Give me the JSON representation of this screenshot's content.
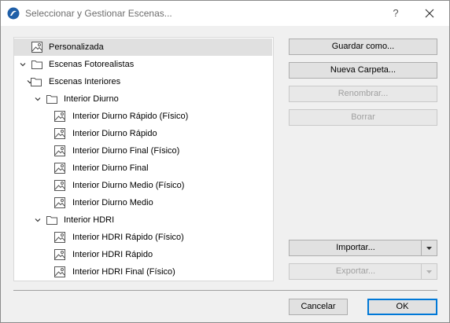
{
  "window": {
    "title": "Seleccionar y Gestionar Escenas...",
    "help_label": "?"
  },
  "tree": {
    "items": [
      {
        "label": "Personalizada",
        "level": 0,
        "type": "scene",
        "selected": true,
        "expanded": null
      },
      {
        "label": "Escenas Fotorealistas",
        "level": 0,
        "type": "folder",
        "selected": false,
        "expanded": true
      },
      {
        "label": "Escenas Interiores",
        "level": 1,
        "type": "folder",
        "selected": false,
        "expanded": true
      },
      {
        "label": "Interior Diurno",
        "level": 2,
        "type": "folder",
        "selected": false,
        "expanded": true
      },
      {
        "label": "Interior Diurno Rápido (Físico)",
        "level": 3,
        "type": "scene",
        "selected": false,
        "expanded": null
      },
      {
        "label": "Interior Diurno Rápido",
        "level": 3,
        "type": "scene",
        "selected": false,
        "expanded": null
      },
      {
        "label": "Interior Diurno Final (Físico)",
        "level": 3,
        "type": "scene",
        "selected": false,
        "expanded": null
      },
      {
        "label": "Interior Diurno Final",
        "level": 3,
        "type": "scene",
        "selected": false,
        "expanded": null
      },
      {
        "label": "Interior Diurno Medio (Físico)",
        "level": 3,
        "type": "scene",
        "selected": false,
        "expanded": null
      },
      {
        "label": "Interior Diurno Medio",
        "level": 3,
        "type": "scene",
        "selected": false,
        "expanded": null
      },
      {
        "label": "Interior HDRI",
        "level": 2,
        "type": "folder",
        "selected": false,
        "expanded": true
      },
      {
        "label": "Interior HDRI Rápido (Físico)",
        "level": 3,
        "type": "scene",
        "selected": false,
        "expanded": null
      },
      {
        "label": "Interior HDRI Rápido",
        "level": 3,
        "type": "scene",
        "selected": false,
        "expanded": null
      },
      {
        "label": "Interior HDRI Final (Físico)",
        "level": 3,
        "type": "scene",
        "selected": false,
        "expanded": null
      }
    ]
  },
  "actions": {
    "save_as": "Guardar como...",
    "new_folder": "Nueva Carpeta...",
    "rename": "Renombrar...",
    "delete": "Borrar",
    "import": "Importar...",
    "export": "Exportar...",
    "cancel": "Cancelar",
    "ok": "OK"
  },
  "colors": {
    "accent": "#0078d7",
    "selection": "#e0e0e0",
    "disabled_text": "#a0a0a0"
  }
}
